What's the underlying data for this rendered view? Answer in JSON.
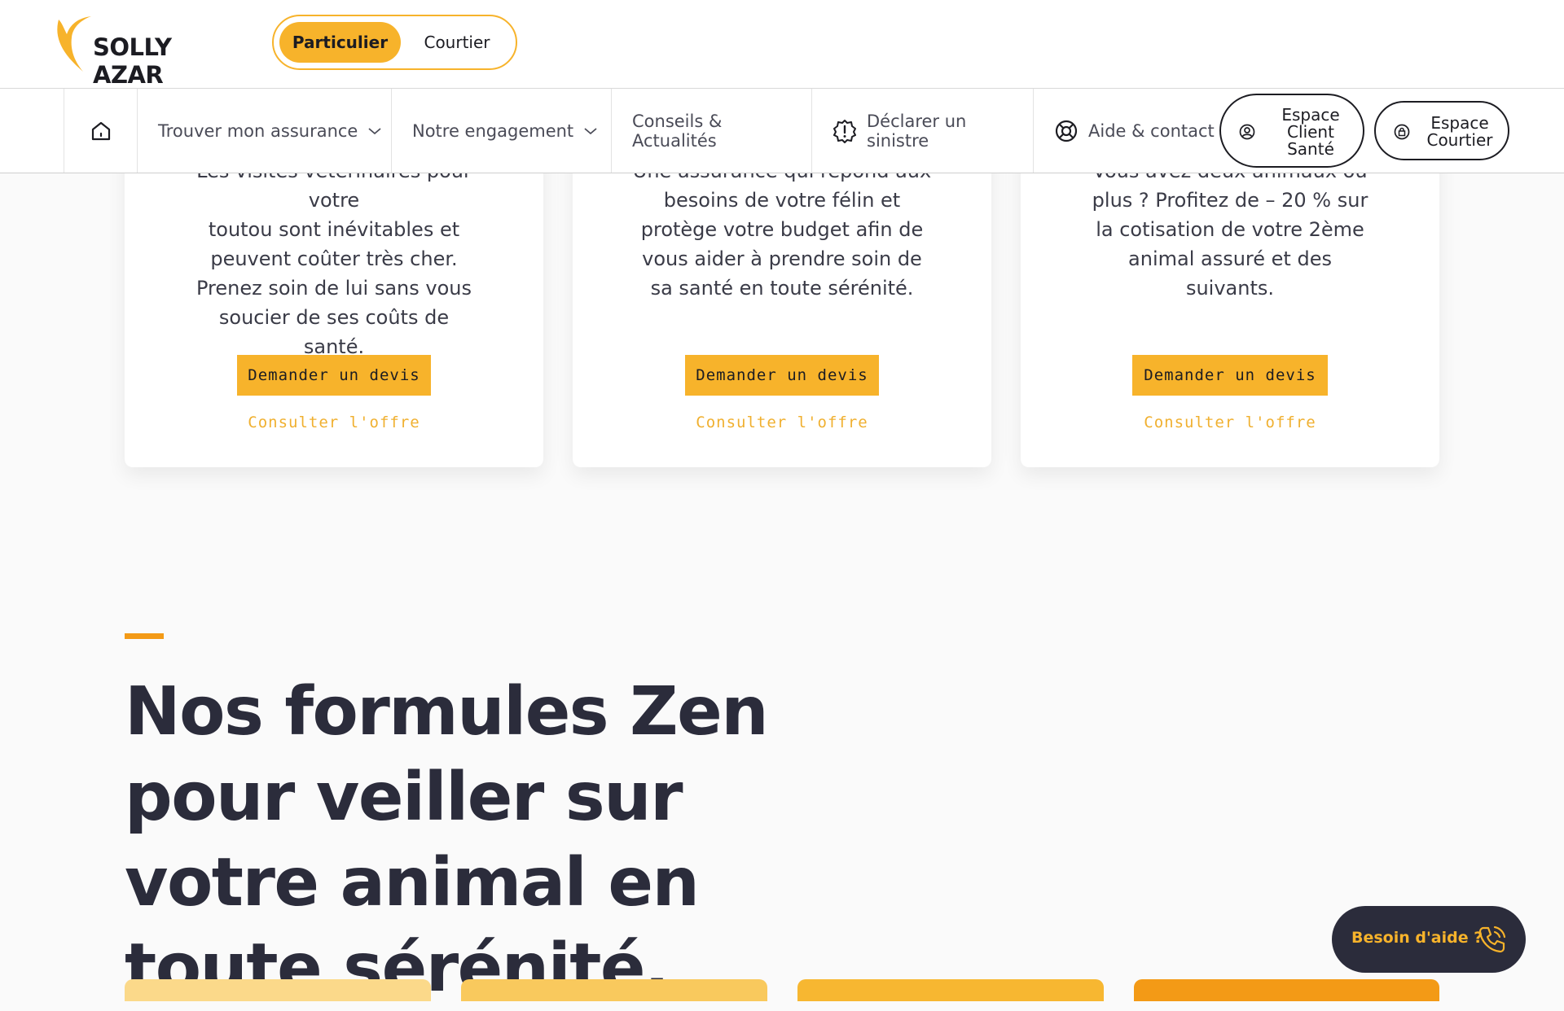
{
  "brand": {
    "logo_text": "SOLLY AZAR",
    "colors": {
      "accent": "#f7b32b",
      "accent_dark": "#f39a16",
      "dark": "#2b2c3b"
    }
  },
  "audience_switch": {
    "active": "Particulier",
    "inactive": "Courtier"
  },
  "nav": {
    "home_icon": "home-icon",
    "items": [
      {
        "label": "Trouver mon assurance",
        "icon": "chevron-down-icon"
      },
      {
        "label": "Notre engagement",
        "icon": "chevron-down-icon"
      },
      {
        "label": "Conseils & Actualités"
      },
      {
        "label": "Déclarer un sinistre",
        "icon": "alert-badge-icon"
      },
      {
        "label": "Aide & contact",
        "icon": "lifebuoy-icon"
      }
    ],
    "buttons": [
      {
        "label": "Espace Client Santé",
        "icon": "user-circle-icon"
      },
      {
        "label": "Espace Courtier",
        "icon": "lock-circle-icon"
      }
    ]
  },
  "cards": [
    {
      "text_clipped": "Les visites vétérinaires pour votre",
      "text": "toutou sont inévitables et peuvent coûter très cher. Prenez soin de lui sans vous soucier de ses coûts de santé.",
      "quote_button": "Demander un devis",
      "offer_link": "Consulter l'offre"
    },
    {
      "text_clipped": "Une assurance qui répond aux",
      "text": "besoins de votre félin et protège votre budget afin de vous aider à prendre soin de sa santé en toute sérénité.",
      "quote_button": "Demander un devis",
      "offer_link": "Consulter l'offre"
    },
    {
      "text_clipped": "Vous avez deux animaux ou",
      "text": "plus ? Profitez de – 20 % sur la cotisation de votre 2ème animal assuré et des suivants.",
      "quote_button": "Demander un devis",
      "offer_link": "Consulter l'offre"
    }
  ],
  "section": {
    "title": "Nos formules Zen pour veiller sur votre animal en toute sérénité."
  },
  "plan_colors": [
    "#fbd98a",
    "#f9c95d",
    "#f7b731",
    "#f39a16"
  ],
  "help": {
    "label": "Besoin d'aide ?",
    "icon": "phone-ring-icon"
  }
}
